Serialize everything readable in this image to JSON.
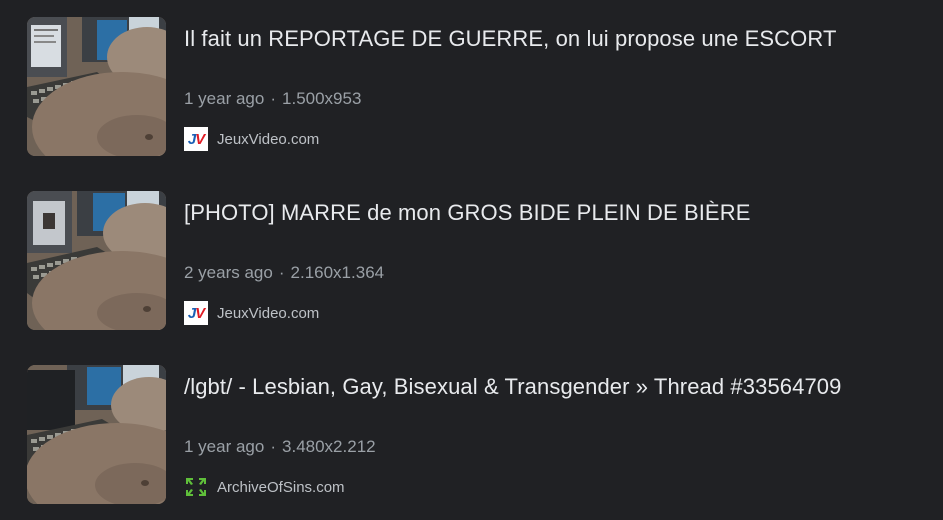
{
  "results": [
    {
      "title": "Il fait un REPORTAGE DE GUERRE, on lui propose une ESCORT",
      "age": "1 year ago",
      "separator": "·",
      "dimensions": "1.500x953",
      "source": "JeuxVideo.com",
      "favicon": "jeuxvideo-icon"
    },
    {
      "title": "[PHOTO] MARRE de mon GROS BIDE PLEIN DE BIÈRE",
      "age": "2 years ago",
      "separator": "·",
      "dimensions": "2.160x1.364",
      "source": "JeuxVideo.com",
      "favicon": "jeuxvideo-icon"
    },
    {
      "title": "/lgbt/ - Lesbian, Gay, Bisexual & Transgender » Thread #33564709",
      "age": "1 year ago",
      "separator": "·",
      "dimensions": "3.480x2.212",
      "source": "ArchiveOfSins.com",
      "favicon": "archiveofsins-icon"
    }
  ],
  "colors": {
    "background": "#202124",
    "title": "#e8eaed",
    "meta": "#9aa0a6",
    "source": "#bdc1c6",
    "jv_blue": "#1a5fb4",
    "jv_red": "#e01b24",
    "aos_green": "#5fbf3a"
  }
}
